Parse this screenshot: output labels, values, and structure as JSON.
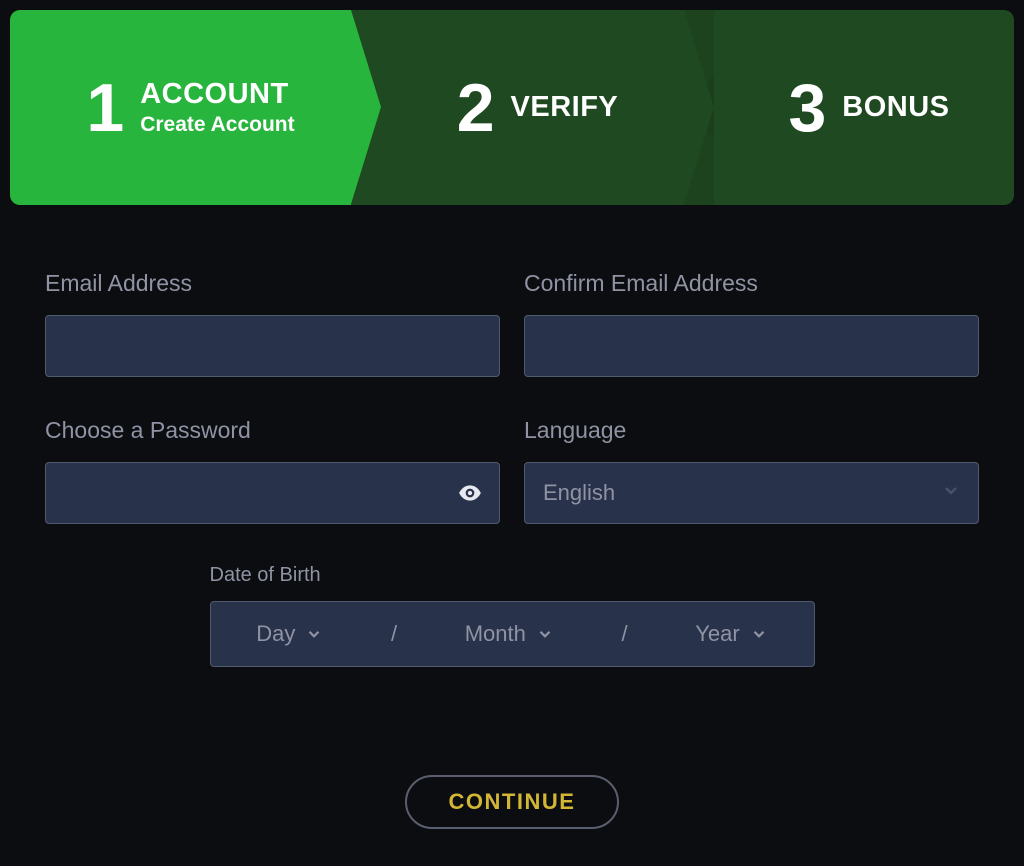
{
  "stepper": {
    "steps": [
      {
        "number": "1",
        "title": "ACCOUNT",
        "subtitle": "Create Account"
      },
      {
        "number": "2",
        "title": "VERIFY"
      },
      {
        "number": "3",
        "title": "BONUS"
      }
    ]
  },
  "form": {
    "email_label": "Email Address",
    "confirm_email_label": "Confirm Email Address",
    "password_label": "Choose a Password",
    "language_label": "Language",
    "language_value": "English",
    "dob_label": "Date of Birth",
    "dob_day": "Day",
    "dob_month": "Month",
    "dob_year": "Year",
    "dob_sep": "/",
    "email_value": "",
    "confirm_email_value": "",
    "password_value": ""
  },
  "actions": {
    "continue_label": "CONTINUE"
  }
}
